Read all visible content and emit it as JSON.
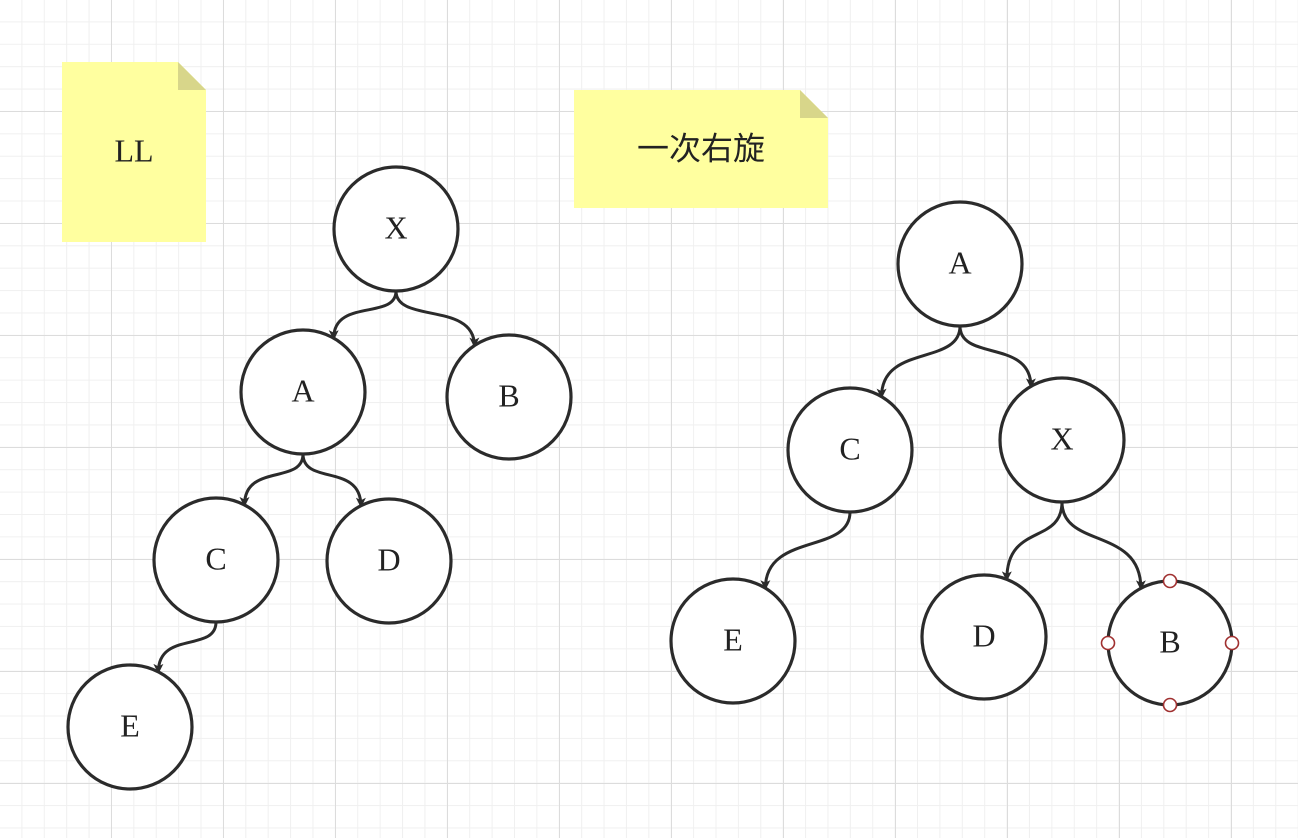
{
  "colors": {
    "note_fill": "#ffff9f",
    "note_fold": "#d8d68a",
    "node_stroke": "#2b2b2b",
    "edge_stroke": "#2b2b2b",
    "handle_stroke": "#a03030"
  },
  "diagrams": [
    {
      "id": "before",
      "note_label": "LL",
      "nodes": [
        {
          "id": "X",
          "label": "X"
        },
        {
          "id": "A",
          "label": "A"
        },
        {
          "id": "B",
          "label": "B"
        },
        {
          "id": "C",
          "label": "C"
        },
        {
          "id": "D",
          "label": "D"
        },
        {
          "id": "E",
          "label": "E"
        }
      ],
      "edges": [
        {
          "from": "X",
          "to": "A"
        },
        {
          "from": "X",
          "to": "B"
        },
        {
          "from": "A",
          "to": "C"
        },
        {
          "from": "A",
          "to": "D"
        },
        {
          "from": "C",
          "to": "E"
        }
      ]
    },
    {
      "id": "after",
      "note_label": "一次右旋",
      "nodes": [
        {
          "id": "A",
          "label": "A"
        },
        {
          "id": "C",
          "label": "C"
        },
        {
          "id": "X",
          "label": "X"
        },
        {
          "id": "E",
          "label": "E"
        },
        {
          "id": "D",
          "label": "D"
        },
        {
          "id": "B",
          "label": "B",
          "selected": true
        }
      ],
      "edges": [
        {
          "from": "A",
          "to": "C"
        },
        {
          "from": "A",
          "to": "X"
        },
        {
          "from": "C",
          "to": "E"
        },
        {
          "from": "X",
          "to": "D"
        },
        {
          "from": "X",
          "to": "B"
        }
      ]
    }
  ]
}
